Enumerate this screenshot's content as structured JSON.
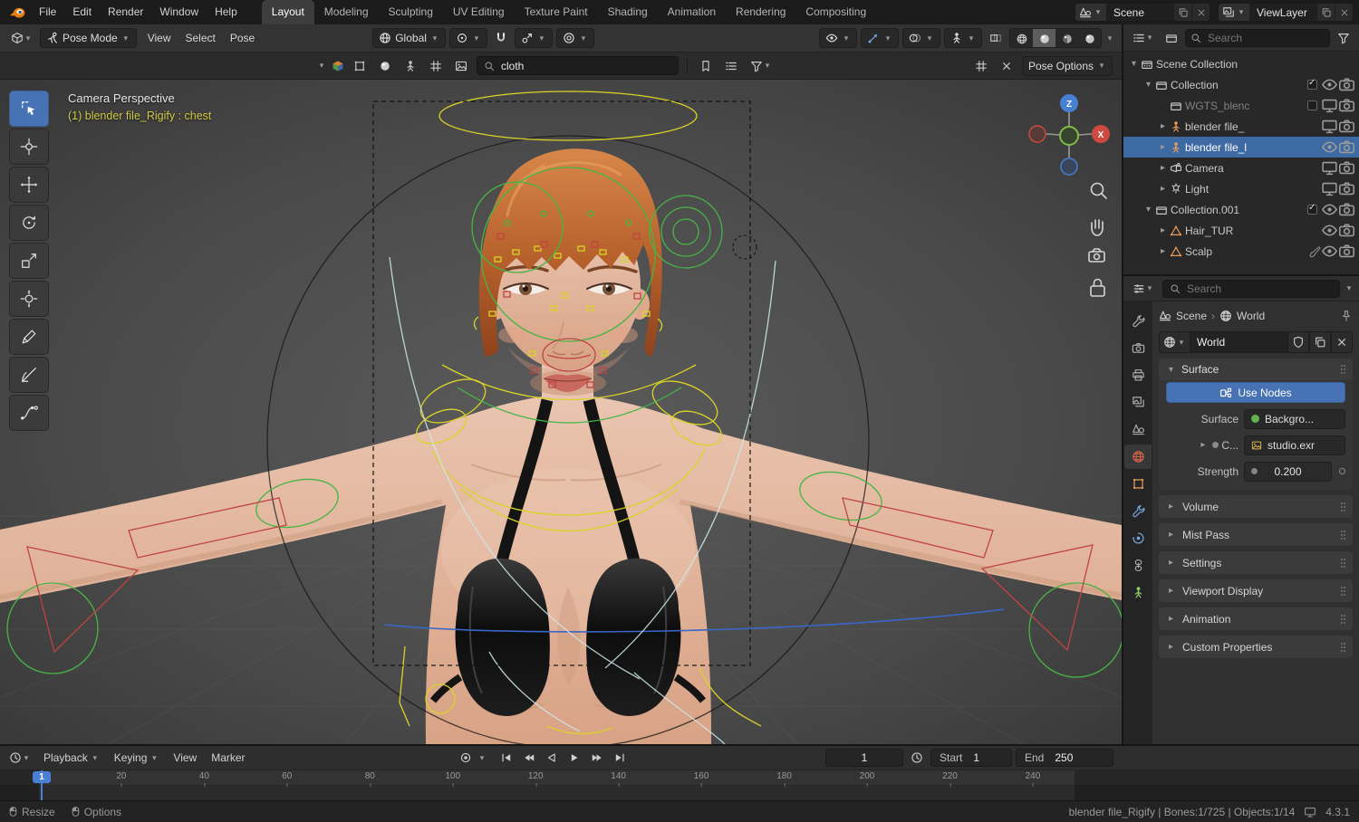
{
  "colors": {
    "accent_blue": "#4772b3",
    "selection_blue": "#3d6aa3",
    "active_text_yellow": "#d2cb45",
    "object_orange": "#ee9e5a",
    "overlay_green": "#46b545",
    "overlay_yellow": "#d9d426",
    "overlay_red": "#c04343"
  },
  "topbar": {
    "menus": [
      "File",
      "Edit",
      "Render",
      "Window",
      "Help"
    ],
    "workspaces": [
      "Layout",
      "Modeling",
      "Sculpting",
      "UV Editing",
      "Texture Paint",
      "Shading",
      "Animation",
      "Rendering",
      "Compositing"
    ],
    "active_workspace": "Layout",
    "scene_label": "Scene",
    "viewlayer_label": "ViewLayer"
  },
  "viewport_header": {
    "mode_label": "Pose Mode",
    "menus": [
      "View",
      "Select",
      "Pose"
    ],
    "orientation_label": "Global"
  },
  "tool_settings": {
    "search_value": "cloth",
    "pose_options_label": "Pose Options"
  },
  "toolbar_tools": [
    "tweak",
    "cursor",
    "move",
    "rotate",
    "scale",
    "transform",
    "annotate",
    "measure",
    "breakdown"
  ],
  "viewport": {
    "view_label": "Camera Perspective",
    "active_item_label": "(1) blender file_Rigify : chest",
    "axis_z": "Z",
    "axis_x": "X"
  },
  "outliner": {
    "search_placeholder": "Search",
    "rows": [
      {
        "label": "Scene Collection",
        "icon": "scene-collection",
        "indent": 0,
        "expander": "open",
        "toggles": []
      },
      {
        "label": "Collection",
        "icon": "collection",
        "indent": 1,
        "expander": "open",
        "toggles": [
          "checkbox",
          "eye",
          "camera"
        ]
      },
      {
        "label": "WGTS_blenc",
        "icon": "collection",
        "indent": 2,
        "expander": "none",
        "muted": true,
        "toggles": [
          "checkbox-empty",
          "screen",
          "camera"
        ]
      },
      {
        "label": "blender file_",
        "icon": "armature",
        "indent": 2,
        "expander": "closed",
        "toggles": [
          "screen",
          "camera"
        ]
      },
      {
        "label": "blender file_l",
        "icon": "armature",
        "indent": 2,
        "expander": "closed",
        "selected": true,
        "toggles": [
          "eye",
          "camera"
        ]
      },
      {
        "label": "Camera",
        "icon": "camera-obj",
        "indent": 2,
        "expander": "closed",
        "toggles": [
          "screen",
          "camera"
        ]
      },
      {
        "label": "Light",
        "icon": "light",
        "indent": 2,
        "expander": "closed",
        "toggles": [
          "screen",
          "camera"
        ]
      },
      {
        "label": "Collection.001",
        "icon": "collection",
        "indent": 1,
        "expander": "open",
        "toggles": [
          "checkbox",
          "eye",
          "camera"
        ]
      },
      {
        "label": "Hair_TUR",
        "icon": "mesh",
        "indent": 2,
        "expander": "closed",
        "toggles": [
          "eye",
          "camera"
        ]
      },
      {
        "label": "Scalp",
        "icon": "mesh",
        "indent": 2,
        "expander": "closed",
        "extra": "brush",
        "toggles": [
          "eye",
          "camera"
        ]
      }
    ]
  },
  "properties": {
    "search_placeholder": "Search",
    "tabs": [
      "tool",
      "render",
      "output",
      "viewlayer",
      "scene",
      "world",
      "object",
      "modifiers",
      "physics",
      "constraints",
      "data"
    ],
    "active_tab": "world",
    "breadcrumb": {
      "scene": "Scene",
      "world": "World"
    },
    "world_name": "World",
    "surface_panel": {
      "title": "Surface",
      "use_nodes_label": "Use Nodes",
      "surface_label": "Surface",
      "surface_value": "Backgro...",
      "color_label": "C...",
      "color_value": "studio.exr",
      "strength_label": "Strength",
      "strength_value": "0.200"
    },
    "collapsed_panels": [
      "Volume",
      "Mist Pass",
      "Settings",
      "Viewport Display",
      "Animation",
      "Custom Properties"
    ]
  },
  "timeline": {
    "menus": [
      {
        "label": "Playback",
        "dropdown": true
      },
      {
        "label": "Keying",
        "dropdown": true
      },
      {
        "label": "View",
        "dropdown": false
      },
      {
        "label": "Marker",
        "dropdown": false
      }
    ],
    "current_frame": "1",
    "start_label": "Start",
    "start_value": "1",
    "end_label": "End",
    "end_value": "250",
    "frame_ticks": [
      20,
      40,
      60,
      80,
      100,
      120,
      140,
      160,
      180,
      200,
      220,
      240
    ],
    "frame_start": 1,
    "frame_end": 250
  },
  "statusbar": {
    "left_items": [
      "Resize",
      "Options"
    ],
    "info": "blender file_Rigify | Bones:1/725 | Objects:1/14",
    "version": "4.3.1"
  }
}
